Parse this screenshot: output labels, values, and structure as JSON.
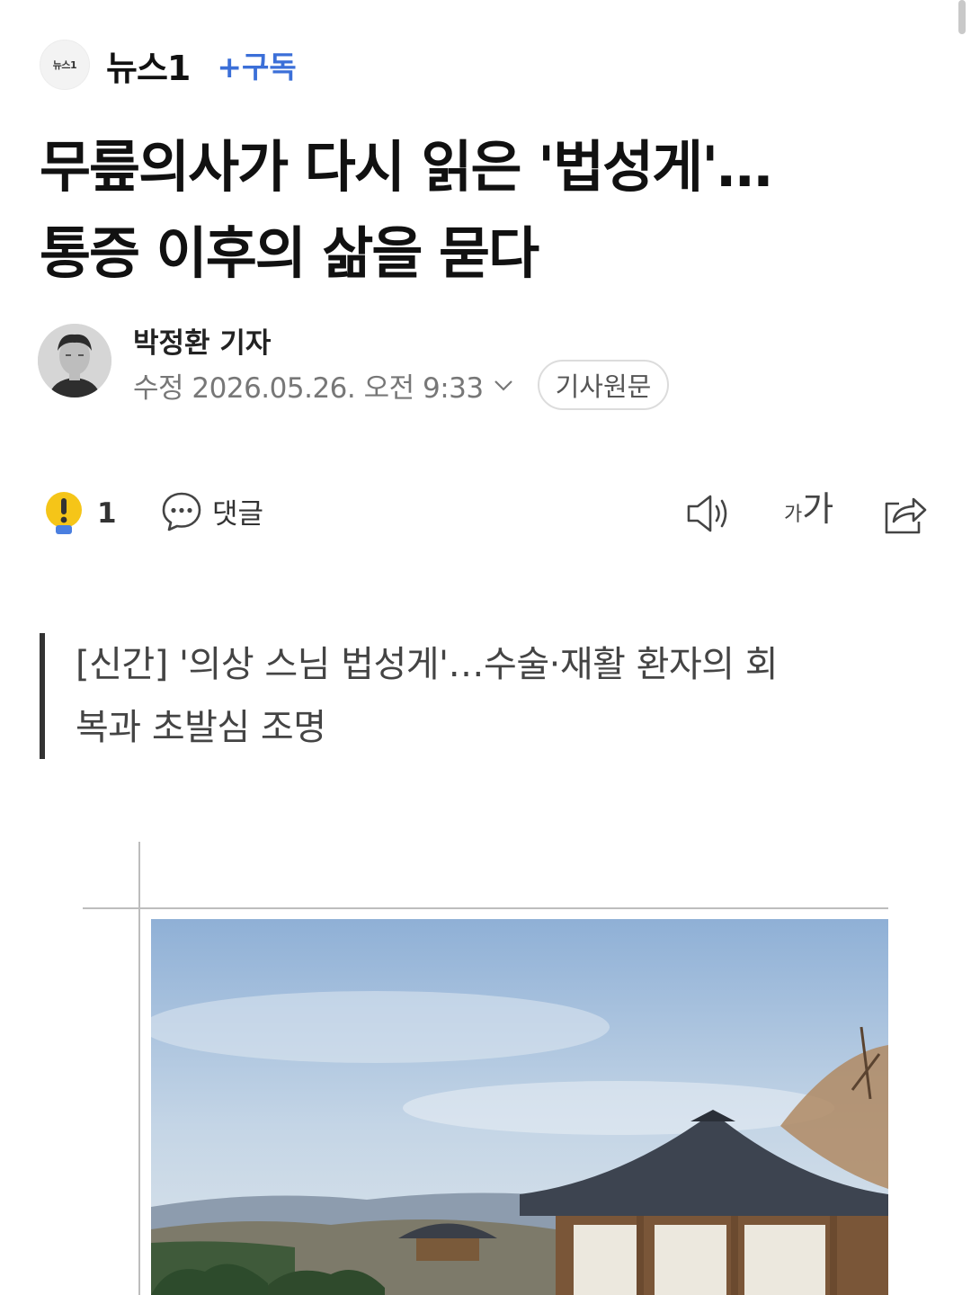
{
  "press": {
    "logo_text": "뉴스1",
    "name": "뉴스1",
    "subscribe_label": "+구독"
  },
  "article": {
    "title_line1": "무릎의사가 다시 읽은 '법성게'…",
    "title_line2": "통증 이후의 삶을 묻다",
    "reporter": "박정환 기자",
    "updated": "수정 2026.05.26. 오전 9:33",
    "original_label": "기사원문",
    "subtitle_line1": "[신간] '의상 스님 법성게'…수술·재활 환자의 회",
    "subtitle_line2": "복과 초발심 조명"
  },
  "toolbar": {
    "reaction_count": "1",
    "comment_label": "댓글",
    "font_small": "가",
    "font_big": "가"
  },
  "icons": {
    "reaction": "exclamation-bulb-icon",
    "comment": "speech-bubble-icon",
    "tts": "speaker-icon",
    "font_size": "font-size-icon",
    "share": "share-icon",
    "expand": "chevron-down-icon"
  },
  "colors": {
    "accent": "#3b6fd8",
    "reaction_yellow": "#f5c518",
    "reaction_blue": "#4a7fe0"
  }
}
